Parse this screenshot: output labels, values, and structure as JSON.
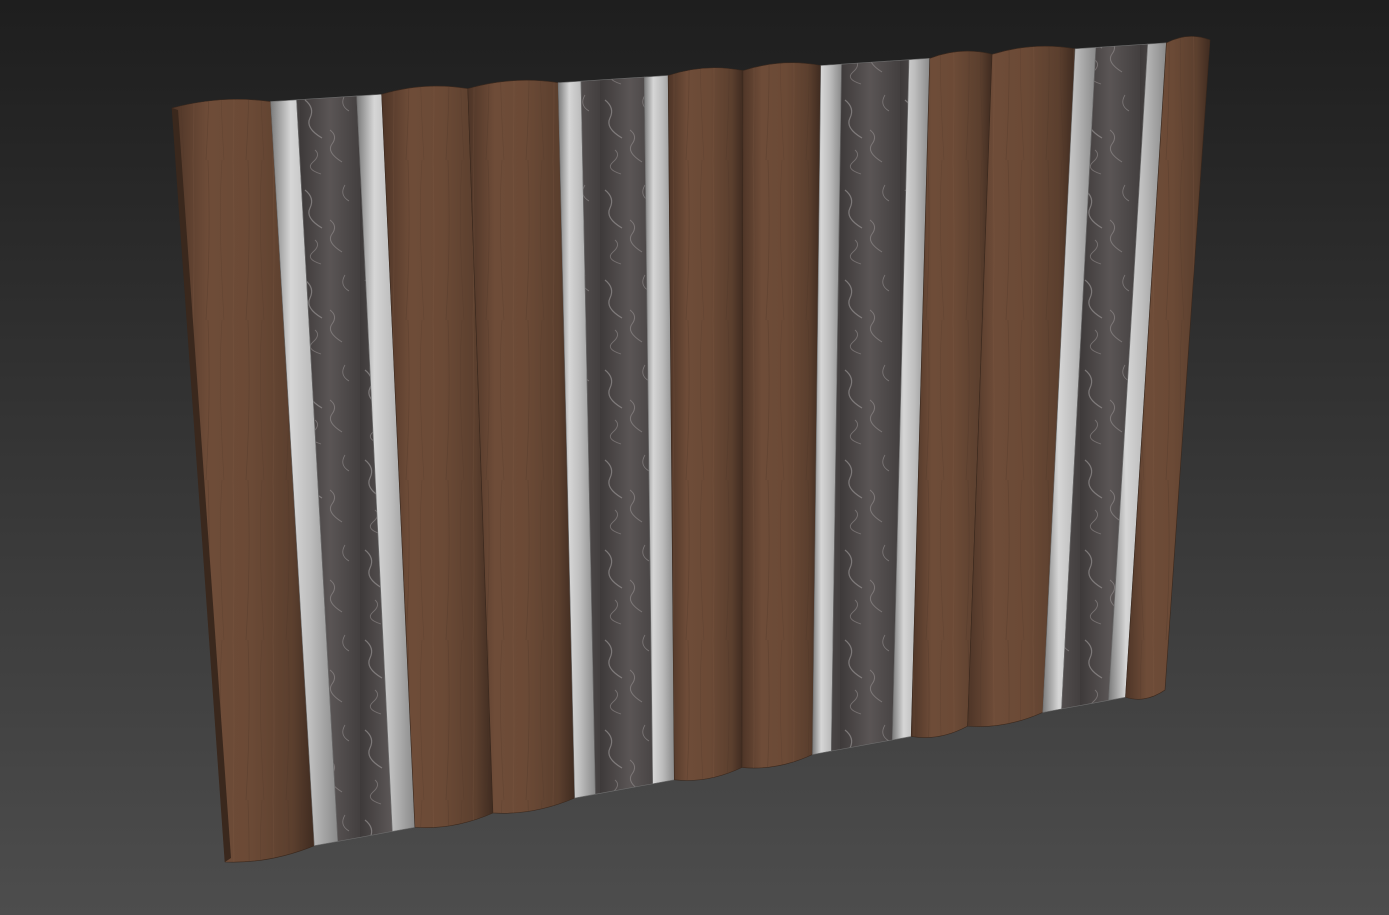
{
  "viewport": {
    "background_top": "#1e1e1e",
    "background_bottom": "#4d4d4d"
  },
  "panel": {
    "description_colors": {
      "wood_dark": "#4a3325",
      "wood_mid": "#6b4a36",
      "wood_light": "#7a5742",
      "metal_light": "#d6d6d6",
      "metal_mid": "#a9a9a9",
      "metal_dark": "#7b7b7b",
      "stone_dark": "#4a4646",
      "stone_mid": "#5e5959",
      "stone_vein": "#a8a3a3"
    },
    "stripe_pattern": [
      "wood",
      "metal-stone-metal",
      "wood",
      "wood",
      "metal-stone-metal",
      "wood",
      "wood",
      "metal-stone-metal",
      "wood",
      "wood",
      "metal-stone-metal",
      "wood"
    ]
  }
}
